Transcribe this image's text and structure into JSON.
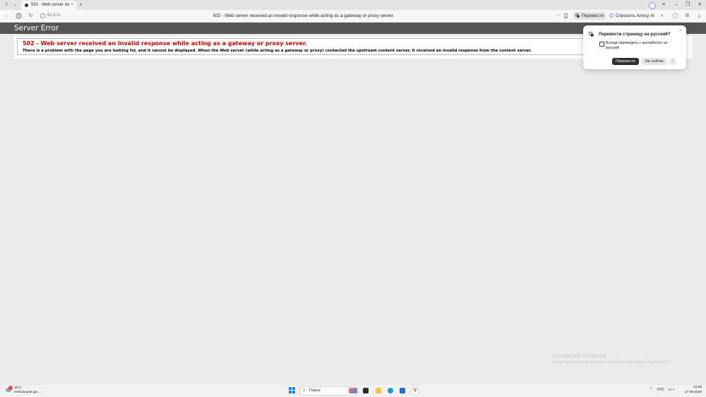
{
  "browser": {
    "tab": {
      "title": "502 - Web server recei…",
      "number": "1"
    },
    "address_bar": {
      "domain": "62-lf.ru",
      "page_title": "502 - Web server received an invalid response while acting as a gateway or proxy server."
    },
    "toolbar": {
      "translate_label": "Перевести",
      "alice_label": "Спросить Алису AI"
    }
  },
  "page": {
    "header": "Server Error",
    "error_heading": "502 - Web server received an invalid response while acting as a gateway or proxy server.",
    "error_body": "There is a problem with the page you are looking for, and it cannot be displayed. When the Web server (while acting as a gateway or proxy) contacted the upstream content server, it received an invalid response from the content server."
  },
  "translate_popup": {
    "title": "Перевести страницу на русский?",
    "checkbox_label": "Всегда переводить с английского на русский",
    "checkbox_checked": false,
    "translate_button": "Перевести",
    "later_button": "Не сейчас"
  },
  "watermark": {
    "title": "Активация Windows",
    "subtitle": "Чтобы активировать Windows, перейдите в раздел \"Параметры\"."
  },
  "taskbar": {
    "weather_temp": "18°C",
    "weather_condition": "Небольшой до...",
    "weather_badge": "1",
    "search_label": "Поиск",
    "language": "РУС",
    "time": "13:59",
    "date": "27.08.2026"
  },
  "colors": {
    "header_band": "#555555",
    "error_heading": "#cc0000",
    "popup_primary": "#2e2e2e"
  }
}
